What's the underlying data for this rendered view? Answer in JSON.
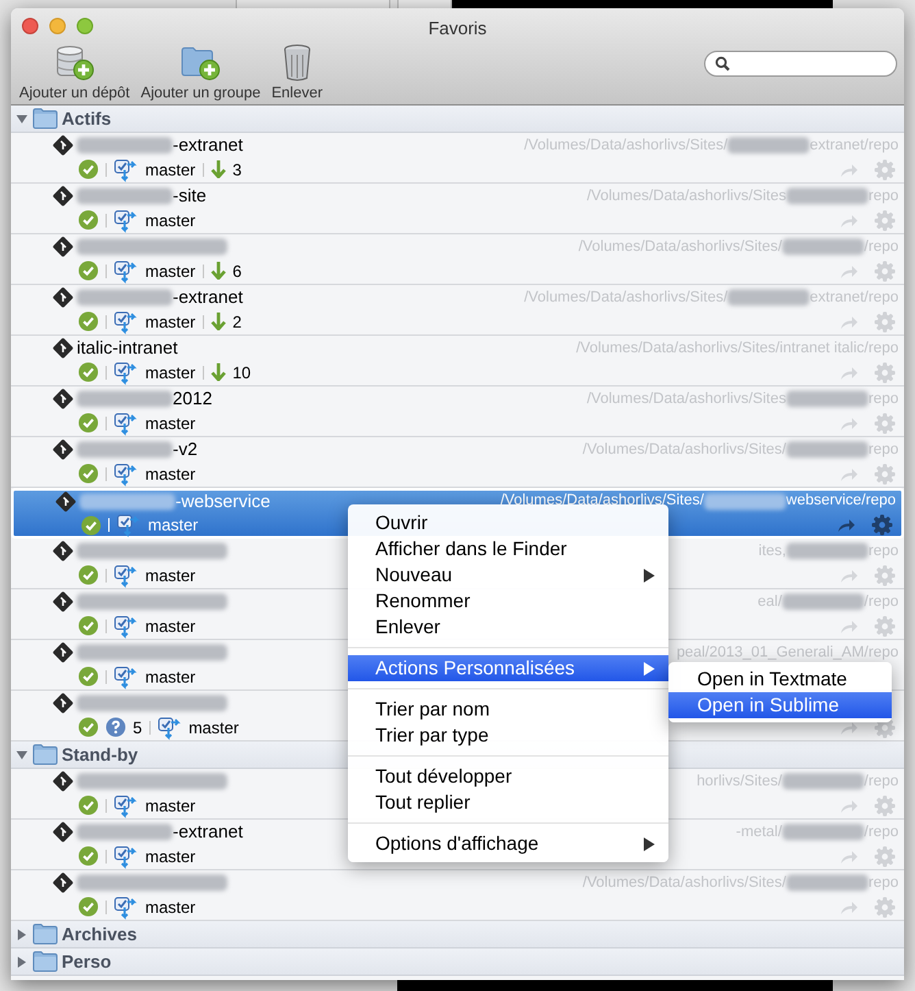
{
  "window": {
    "title": "Favoris"
  },
  "toolbar": [
    {
      "kind": "add-repo",
      "label": "Ajouter un dépôt"
    },
    {
      "kind": "add-group",
      "label": "Ajouter un groupe"
    },
    {
      "kind": "remove",
      "label": "Enlever"
    }
  ],
  "groups": [
    {
      "name": "Actifs",
      "expanded": true,
      "repos": [
        {
          "name_parts": [
            {
              "kind": "redacted"
            },
            {
              "kind": "text",
              "text": "-extranet"
            }
          ],
          "path_parts": [
            {
              "kind": "text",
              "text": "/Volumes/Data/ashorlivs/Sites/"
            },
            {
              "kind": "redacted"
            },
            {
              "kind": "text",
              "text": "extranet/repo"
            }
          ],
          "selected": false,
          "branch": "master",
          "behind": "3"
        },
        {
          "name_parts": [
            {
              "kind": "redacted"
            },
            {
              "kind": "text",
              "text": "-site"
            }
          ],
          "path_parts": [
            {
              "kind": "text",
              "text": "/Volumes/Data/ashorlivs/Sites"
            },
            {
              "kind": "redacted"
            },
            {
              "kind": "text",
              "text": "repo"
            }
          ],
          "selected": false,
          "branch": "master"
        },
        {
          "name_parts": [
            {
              "kind": "redacted"
            }
          ],
          "path_parts": [
            {
              "kind": "text",
              "text": "/Volumes/Data/ashorlivs/Sites/"
            },
            {
              "kind": "redacted"
            },
            {
              "kind": "text",
              "text": "/repo"
            }
          ],
          "selected": false,
          "branch": "master",
          "behind": "6"
        },
        {
          "name_parts": [
            {
              "kind": "redacted"
            },
            {
              "kind": "text",
              "text": "-extranet"
            }
          ],
          "path_parts": [
            {
              "kind": "text",
              "text": "/Volumes/Data/ashorlivs/Sites/"
            },
            {
              "kind": "redacted"
            },
            {
              "kind": "text",
              "text": "extranet/repo"
            }
          ],
          "selected": false,
          "branch": "master",
          "behind": "2"
        },
        {
          "name_parts": [
            {
              "kind": "text",
              "text": "italic-intranet"
            }
          ],
          "path_parts": [
            {
              "kind": "text",
              "text": "/Volumes/Data/ashorlivs/Sites/intranet italic/repo"
            }
          ],
          "selected": false,
          "branch": "master",
          "behind": "10"
        },
        {
          "name_parts": [
            {
              "kind": "redacted"
            },
            {
              "kind": "text",
              "text": "2012"
            }
          ],
          "path_parts": [
            {
              "kind": "text",
              "text": "/Volumes/Data/ashorlivs/Sites"
            },
            {
              "kind": "redacted"
            },
            {
              "kind": "text",
              "text": "repo"
            }
          ],
          "selected": false,
          "branch": "master"
        },
        {
          "name_parts": [
            {
              "kind": "redacted"
            },
            {
              "kind": "text",
              "text": "-v2"
            }
          ],
          "path_parts": [
            {
              "kind": "text",
              "text": "/Volumes/Data/ashorlivs/Sites/"
            },
            {
              "kind": "redacted"
            },
            {
              "kind": "text",
              "text": "repo"
            }
          ],
          "selected": false,
          "branch": "master"
        },
        {
          "name_parts": [
            {
              "kind": "redacted"
            },
            {
              "kind": "text",
              "text": "-webservice"
            }
          ],
          "path_parts": [
            {
              "kind": "text",
              "text": "/Volumes/Data/ashorlivs/Sites/"
            },
            {
              "kind": "redacted"
            },
            {
              "kind": "text",
              "text": "webservice/repo"
            }
          ],
          "selected": true,
          "branch": "master"
        },
        {
          "name_parts": [
            {
              "kind": "redacted"
            }
          ],
          "path_parts": [
            {
              "kind": "text",
              "text": "ites,"
            },
            {
              "kind": "redacted"
            },
            {
              "kind": "text",
              "text": "repo"
            }
          ],
          "selected": false,
          "branch": "master"
        },
        {
          "name_parts": [
            {
              "kind": "redacted"
            }
          ],
          "path_parts": [
            {
              "kind": "text",
              "text": "eal/"
            },
            {
              "kind": "redacted"
            },
            {
              "kind": "text",
              "text": "/repo"
            }
          ],
          "selected": false,
          "branch": "master"
        },
        {
          "name_parts": [
            {
              "kind": "redacted"
            }
          ],
          "path_parts": [
            {
              "kind": "text",
              "text": "peal/2013_01_Generali_AM/repo"
            }
          ],
          "selected": false,
          "actions_hidden": true,
          "branch": "master"
        },
        {
          "name_parts": [
            {
              "kind": "redacted"
            }
          ],
          "selected": false,
          "unknown": "5",
          "branch": "master"
        }
      ]
    },
    {
      "name": "Stand-by",
      "expanded": true,
      "repos": [
        {
          "name_parts": [
            {
              "kind": "redacted"
            }
          ],
          "path_parts": [
            {
              "kind": "text",
              "text": "horlivs/Sites/"
            },
            {
              "kind": "redacted"
            },
            {
              "kind": "text",
              "text": "/repo"
            }
          ],
          "selected": false,
          "branch": "master"
        },
        {
          "name_parts": [
            {
              "kind": "redacted"
            },
            {
              "kind": "text",
              "text": "-extranet"
            }
          ],
          "path_parts": [
            {
              "kind": "text",
              "text": "-metal/"
            },
            {
              "kind": "redacted"
            },
            {
              "kind": "text",
              "text": "/repo"
            }
          ],
          "selected": false,
          "branch": "master"
        },
        {
          "name_parts": [
            {
              "kind": "redacted"
            }
          ],
          "path_parts": [
            {
              "kind": "text",
              "text": "/Volumes/Data/ashorlivs/Sites/"
            },
            {
              "kind": "redacted"
            },
            {
              "kind": "text",
              "text": "repo"
            }
          ],
          "selected": false,
          "branch": "master"
        }
      ]
    },
    {
      "name": "Archives",
      "expanded": false
    },
    {
      "name": "Perso",
      "expanded": false
    }
  ],
  "context_menu": {
    "items": [
      {
        "kind": "item",
        "label": "Ouvrir",
        "submenu": false,
        "highlighted": false
      },
      {
        "kind": "item",
        "label": "Afficher dans le Finder",
        "submenu": false,
        "highlighted": false
      },
      {
        "kind": "item",
        "label": "Nouveau",
        "submenu": true,
        "highlighted": false
      },
      {
        "kind": "item",
        "label": "Renommer",
        "submenu": false,
        "highlighted": false
      },
      {
        "kind": "item",
        "label": "Enlever",
        "submenu": false,
        "highlighted": false
      },
      {
        "kind": "separator"
      },
      {
        "kind": "item",
        "label": "Actions Personnalisées",
        "submenu": true,
        "highlighted": true
      },
      {
        "kind": "separator"
      },
      {
        "kind": "item",
        "label": "Trier par nom",
        "submenu": false,
        "highlighted": false
      },
      {
        "kind": "item",
        "label": "Trier par type",
        "submenu": false,
        "highlighted": false
      },
      {
        "kind": "separator"
      },
      {
        "kind": "item",
        "label": "Tout développer",
        "submenu": false,
        "highlighted": false
      },
      {
        "kind": "item",
        "label": "Tout replier",
        "submenu": false,
        "highlighted": false
      },
      {
        "kind": "separator"
      },
      {
        "kind": "item",
        "label": "Options d'affichage",
        "submenu": true,
        "highlighted": false
      }
    ],
    "submenu": [
      {
        "label": "Open in Textmate",
        "highlighted": false
      },
      {
        "label": "Open in Sublime",
        "highlighted": true
      }
    ]
  }
}
